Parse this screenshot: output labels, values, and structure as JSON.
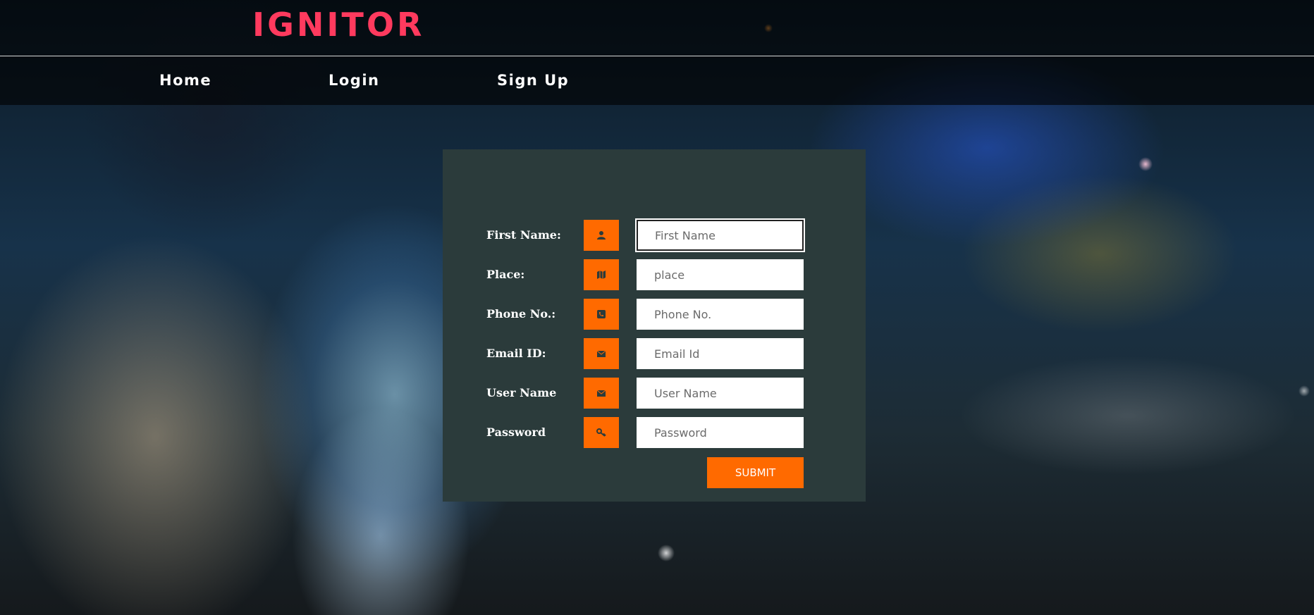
{
  "header": {
    "brand": "IGNITOR"
  },
  "nav": {
    "home": "Home",
    "login": "Login",
    "signup": "Sign Up"
  },
  "form": {
    "fields": [
      {
        "label": "First Name:",
        "placeholder": "First Name",
        "icon": "user-icon"
      },
      {
        "label": "Place:",
        "placeholder": "place",
        "icon": "map-icon"
      },
      {
        "label": "Phone No.:",
        "placeholder": "Phone No.",
        "icon": "phone-icon"
      },
      {
        "label": "Email ID:",
        "placeholder": "Email Id",
        "icon": "envelope-icon"
      },
      {
        "label": "User Name",
        "placeholder": "User Name",
        "icon": "envelope-icon"
      },
      {
        "label": "Password",
        "placeholder": "Password",
        "icon": "key-icon"
      }
    ],
    "submit_label": "SUBMIT"
  },
  "colors": {
    "accent": "#ff6a00",
    "brand": "#ff3a5e",
    "panel": "#2b3b3b"
  }
}
